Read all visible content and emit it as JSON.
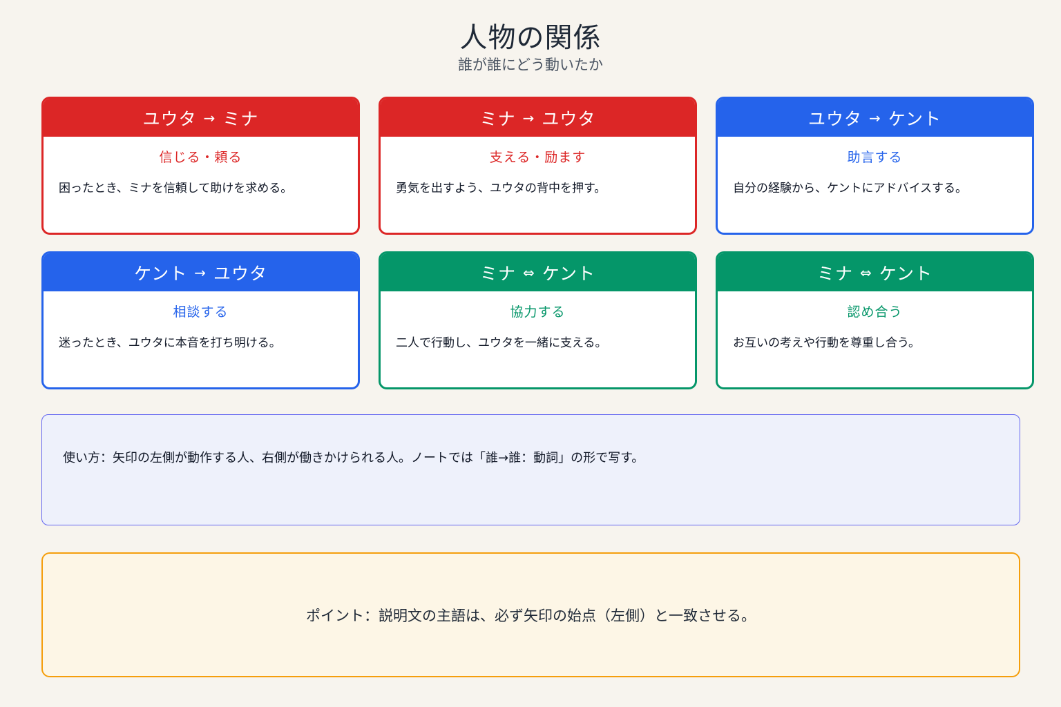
{
  "header": {
    "title": "人物の関係",
    "subtitle": "誰が誰にどう動いたか"
  },
  "colors": {
    "red": "#dc2626",
    "blue": "#2563eb",
    "green": "#059669",
    "howto_border": "#6366f1",
    "point_border": "#f59e0b"
  },
  "cards": [
    {
      "from": "ユウタ",
      "arrow": "→",
      "to": "ミナ",
      "verb": "信じる・頼る",
      "desc": "困ったとき、ミナを信頼して助けを求める。",
      "color": "red"
    },
    {
      "from": "ミナ",
      "arrow": "→",
      "to": "ユウタ",
      "verb": "支える・励ます",
      "desc": "勇気を出すよう、ユウタの背中を押す。",
      "color": "red"
    },
    {
      "from": "ユウタ",
      "arrow": "→",
      "to": "ケント",
      "verb": "助言する",
      "desc": "自分の経験から、ケントにアドバイスする。",
      "color": "blue"
    },
    {
      "from": "ケント",
      "arrow": "→",
      "to": "ユウタ",
      "verb": "相談する",
      "desc": "迷ったとき、ユウタに本音を打ち明ける。",
      "color": "blue"
    },
    {
      "from": "ミナ",
      "arrow": "⇔",
      "to": "ケント",
      "verb": "協力する",
      "desc": "二人で行動し、ユウタを一緒に支える。",
      "color": "green"
    },
    {
      "from": "ミナ",
      "arrow": "⇔",
      "to": "ケント",
      "verb": "認め合う",
      "desc": "お互いの考えや行動を尊重し合う。",
      "color": "green"
    }
  ],
  "howto": {
    "text": "使い方：矢印の左側が動作する人、右側が働きかけられる人。ノートでは「誰→誰：動詞」の形で写す。"
  },
  "point": {
    "text": "ポイント：説明文の主語は、必ず矢印の始点（左側）と一致させる。"
  }
}
